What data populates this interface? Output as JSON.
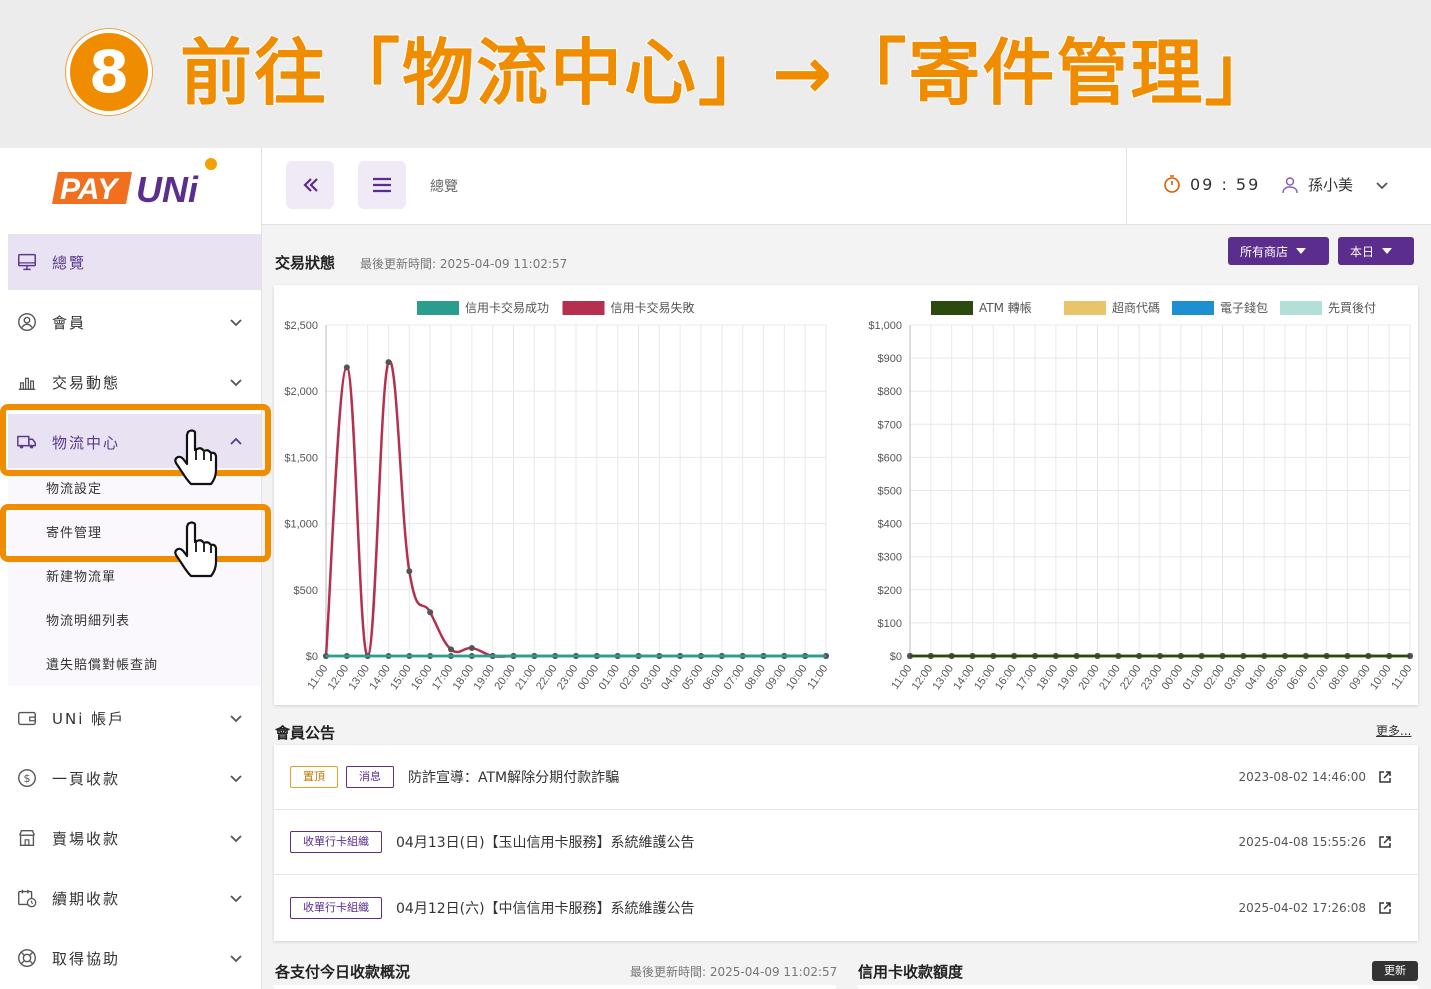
{
  "banner": {
    "step": "8",
    "text": "前往「物流中心」→「寄件管理」"
  },
  "logo": {
    "part1": "PAY",
    "part2": "UNi"
  },
  "sidebar": {
    "items": [
      {
        "label": "總覽"
      },
      {
        "label": "會員"
      },
      {
        "label": "交易動態"
      },
      {
        "label": "物流中心"
      },
      {
        "label": "UNi 帳戶"
      },
      {
        "label": "一頁收款"
      },
      {
        "label": "賣場收款"
      },
      {
        "label": "續期收款"
      },
      {
        "label": "取得協助"
      }
    ],
    "subitems": [
      {
        "label": "物流設定"
      },
      {
        "label": "寄件管理"
      },
      {
        "label": "新建物流單"
      },
      {
        "label": "物流明細列表"
      },
      {
        "label": "遺失賠償對帳查詢"
      }
    ]
  },
  "topbar": {
    "breadcrumb": "總覽",
    "timer": "09 : 59",
    "user": "孫小美"
  },
  "transaction": {
    "title": "交易狀態",
    "updated": "最後更新時間: 2025-04-09 11:02:57",
    "store_btn": "所有商店",
    "period_btn": "本日"
  },
  "chart_data": [
    {
      "type": "line",
      "categories": [
        "11:00",
        "12:00",
        "13:00",
        "14:00",
        "15:00",
        "16:00",
        "17:00",
        "18:00",
        "19:00",
        "20:00",
        "21:00",
        "22:00",
        "23:00",
        "00:00",
        "01:00",
        "02:00",
        "03:00",
        "04:00",
        "05:00",
        "06:00",
        "07:00",
        "08:00",
        "09:00",
        "10:00",
        "11:00"
      ],
      "series": [
        {
          "name": "信用卡交易成功",
          "color": "#2a9d8f",
          "values": [
            0,
            0,
            0,
            0,
            0,
            0,
            0,
            0,
            0,
            0,
            0,
            0,
            0,
            0,
            0,
            0,
            0,
            0,
            0,
            0,
            0,
            0,
            0,
            0,
            0
          ]
        },
        {
          "name": "信用卡交易失敗",
          "color": "#b5304f",
          "values": [
            0,
            2180,
            0,
            2220,
            640,
            330,
            50,
            60,
            0,
            0,
            0,
            0,
            0,
            0,
            0,
            0,
            0,
            0,
            0,
            0,
            0,
            0,
            0,
            0,
            0
          ]
        }
      ],
      "yticks": [
        "$0",
        "$500",
        "$1,000",
        "$1,500",
        "$2,000",
        "$2,500"
      ],
      "ylim": [
        0,
        2500
      ],
      "grid": true,
      "legend": "top"
    },
    {
      "type": "line",
      "categories": [
        "11:00",
        "12:00",
        "13:00",
        "14:00",
        "15:00",
        "16:00",
        "17:00",
        "18:00",
        "19:00",
        "20:00",
        "21:00",
        "22:00",
        "23:00",
        "00:00",
        "01:00",
        "02:00",
        "03:00",
        "04:00",
        "05:00",
        "06:00",
        "07:00",
        "08:00",
        "09:00",
        "10:00",
        "11:00"
      ],
      "series": [
        {
          "name": "ATM 轉帳",
          "color": "#2d4a0e",
          "values": [
            0,
            0,
            0,
            0,
            0,
            0,
            0,
            0,
            0,
            0,
            0,
            0,
            0,
            0,
            0,
            0,
            0,
            0,
            0,
            0,
            0,
            0,
            0,
            0,
            0
          ]
        },
        {
          "name": "超商代碼",
          "color": "#e8c46a",
          "values": [
            0,
            0,
            0,
            0,
            0,
            0,
            0,
            0,
            0,
            0,
            0,
            0,
            0,
            0,
            0,
            0,
            0,
            0,
            0,
            0,
            0,
            0,
            0,
            0,
            0
          ]
        },
        {
          "name": "電子錢包",
          "color": "#1e8fd0",
          "values": [
            0,
            0,
            0,
            0,
            0,
            0,
            0,
            0,
            0,
            0,
            0,
            0,
            0,
            0,
            0,
            0,
            0,
            0,
            0,
            0,
            0,
            0,
            0,
            0,
            0
          ]
        },
        {
          "name": "先買後付",
          "color": "#b2e0d8",
          "values": [
            0,
            0,
            0,
            0,
            0,
            0,
            0,
            0,
            0,
            0,
            0,
            0,
            0,
            0,
            0,
            0,
            0,
            0,
            0,
            0,
            0,
            0,
            0,
            0,
            0
          ]
        }
      ],
      "yticks": [
        "$0",
        "$100",
        "$200",
        "$300",
        "$400",
        "$500",
        "$600",
        "$700",
        "$800",
        "$900",
        "$1,000"
      ],
      "ylim": [
        0,
        1000
      ],
      "grid": true,
      "legend": "top"
    }
  ],
  "notices": {
    "title": "會員公告",
    "more": "更多...",
    "rows": [
      {
        "tags": [
          "置頂",
          "消息"
        ],
        "title": "防詐宣導：ATM解除分期付款詐騙",
        "date": "2023-08-02 14:46:00"
      },
      {
        "tags": [
          "收單行卡組織"
        ],
        "title": "04月13日(日)【玉山信用卡服務】系統維護公告",
        "date": "2025-04-08 15:55:26"
      },
      {
        "tags": [
          "收單行卡組織"
        ],
        "title": "04月12日(六)【中信信用卡服務】系統維護公告",
        "date": "2025-04-02 17:26:08"
      }
    ]
  },
  "bottom": {
    "payments_title": "各支付今日收款概況",
    "payments_updated": "最後更新時間: 2025-04-09 11:02:57",
    "credit_title": "信用卡收款額度",
    "refresh": "更新"
  }
}
